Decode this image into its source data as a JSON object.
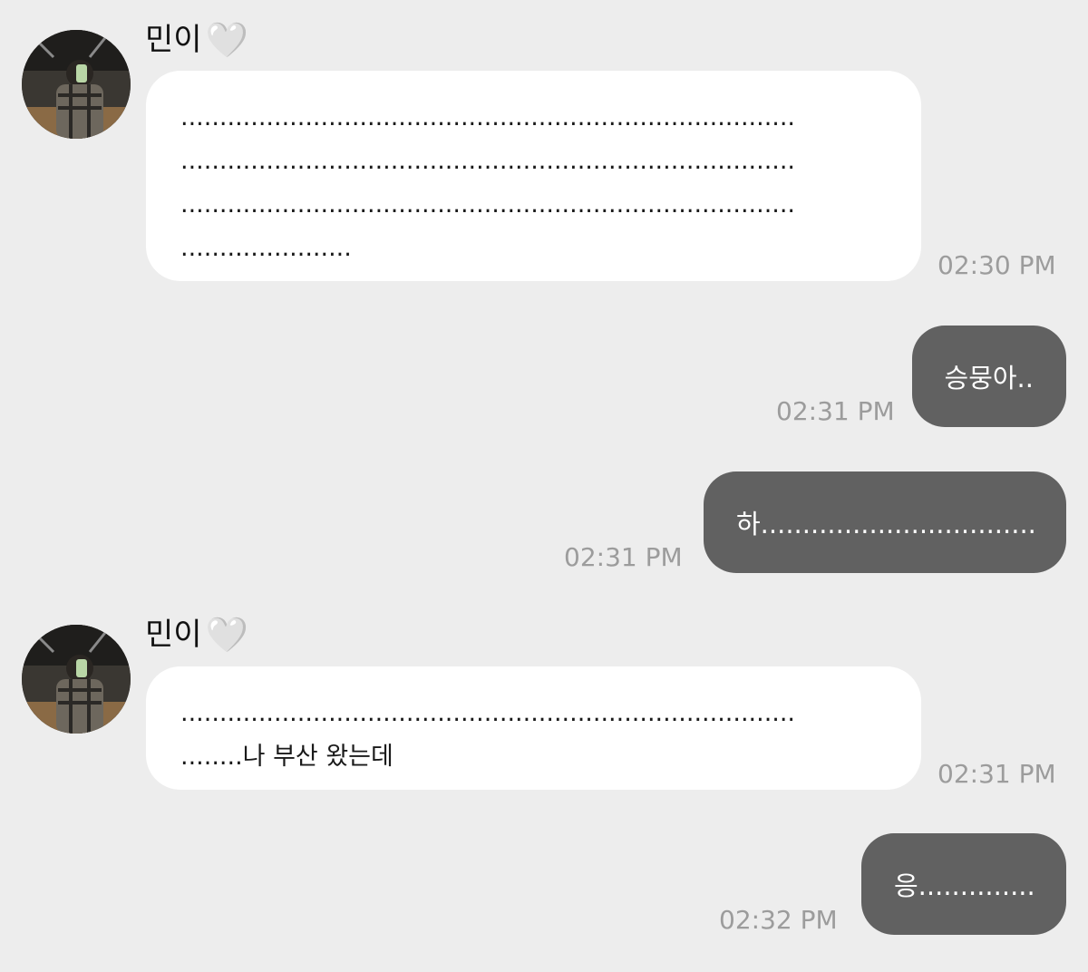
{
  "messages": [
    {
      "sender": "민이",
      "heart": "🤍",
      "avatar_icon": "profile-photo",
      "lines": [
        "...............................................................................",
        "...............................................................................",
        "...............................................................................",
        "......................"
      ],
      "time": "02:30 PM"
    },
    {
      "text": "승뭉아..",
      "time": "02:31 PM"
    },
    {
      "text": "하.................................",
      "time": "02:31 PM"
    },
    {
      "sender": "민이",
      "heart": "🤍",
      "avatar_icon": "profile-photo",
      "lines": [
        "...............................................................................",
        "........나 부산 왔는데"
      ],
      "time": "02:31 PM"
    },
    {
      "text": "응..............",
      "time": "02:32 PM"
    }
  ],
  "colors": {
    "background": "#ededed",
    "incoming_bubble": "#ffffff",
    "outgoing_bubble": "#616161",
    "timestamp": "#9c9c9c"
  }
}
